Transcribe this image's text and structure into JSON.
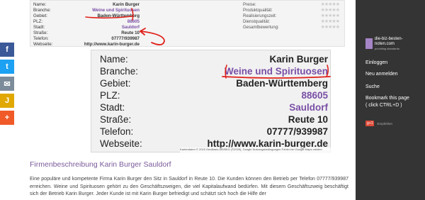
{
  "top_card": {
    "rows": [
      {
        "key": "Name:",
        "value": "Karin Burger"
      },
      {
        "key": "Branche:",
        "value": "Weine und Spirituosen"
      },
      {
        "key": "Gebiet:",
        "value": "Baden-Württemberg"
      },
      {
        "key": "PLZ:",
        "value": "88605"
      },
      {
        "key": "Stadt:",
        "value": "Sauldorf"
      },
      {
        "key": "Straße:",
        "value": "Reute 10"
      },
      {
        "key": "Telefon:",
        "value": "07777/939987"
      },
      {
        "key": "Webseite:",
        "value": "http://www.karin-burger.de"
      }
    ],
    "ratings": [
      "Preise:",
      "Produktqualität:",
      "Realisierungszeit:",
      "Dienstqualität:",
      "Gesamtbewertung:"
    ]
  },
  "big_card": {
    "rows": [
      {
        "key": "Name:",
        "value": "Karin Burger"
      },
      {
        "key": "Branche:",
        "value": "Weine und Spirituosen"
      },
      {
        "key": "Gebiet:",
        "value": "Baden-Württemberg"
      },
      {
        "key": "PLZ:",
        "value": "88605"
      },
      {
        "key": "Stadt:",
        "value": "Sauldorf"
      },
      {
        "key": "Straße:",
        "value": "Reute 10"
      },
      {
        "key": "Telefon:",
        "value": "07777/939987"
      },
      {
        "key": "Webseite:",
        "value": "http://www.karin-burger.de"
      }
    ]
  },
  "map_attribution": "Kartendaten © 2015 GeoBasis-DE/BKG (©2009), Google   Nutzungsbedingungen   Fehler bei Google Maps melden",
  "section_title": "Firmenbeschreibung Karin Burger Sauldorf",
  "description": "Eine populäre und kompetente Firma Karin Burger den Sitz in Sauldorf in Reute 10. Die Kunden können den Betrieb per Telefon 07777/939987 erreichen. Weine und Spirituosen gehört zu den Geschäftszweigen, die viel Kapitalaufwand bedürfen. Mit diesem Geschäftszweig beschäftigt sich der Betrieb Karin Burger. Jeder Kunde ist mit Karin Burger befriedigt und schätzt sich hoch die Hilfe der",
  "sidebar": {
    "logo_title": "die-biz-besten-noten.com",
    "logo_sub": "providing standards",
    "links": [
      "Einloggen",
      "Neu anmelden",
      "Suche",
      "Bookmark this page",
      "( click CTRL+D )"
    ],
    "gplus_badge": "g+1",
    "gplus_text": "Empfehlen"
  },
  "social": [
    {
      "icon": "facebook-icon",
      "glyph": "f",
      "color": "#3b5998"
    },
    {
      "icon": "twitter-icon",
      "glyph": "t",
      "color": "#1da1f2"
    },
    {
      "icon": "email-icon",
      "glyph": "✉",
      "color": "#7d8c9a"
    },
    {
      "icon": "bookmark-icon",
      "glyph": "J",
      "color": "#e0a800"
    },
    {
      "icon": "plus-icon",
      "glyph": "+",
      "color": "#f05a28"
    }
  ],
  "colors": {
    "accent": "#7a4fa6",
    "annotation": "#e0201a",
    "sidebar": "#343434"
  }
}
